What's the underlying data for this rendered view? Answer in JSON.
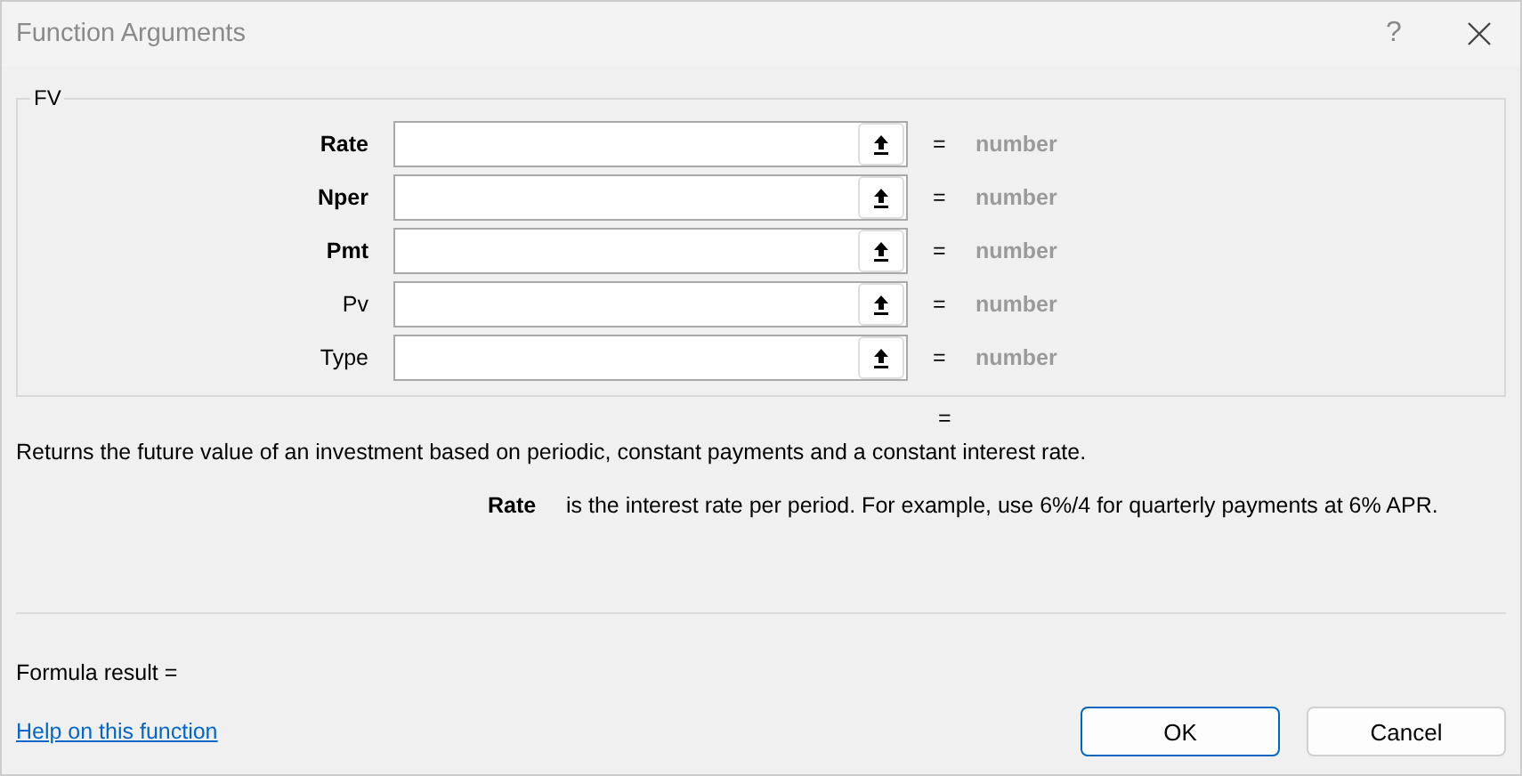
{
  "window": {
    "title": "Function Arguments",
    "help": "?"
  },
  "function": {
    "name": "FV",
    "arguments": [
      {
        "label": "Rate",
        "required": true,
        "equals": "=",
        "result": "number"
      },
      {
        "label": "Nper",
        "required": true,
        "equals": "=",
        "result": "number"
      },
      {
        "label": "Pmt",
        "required": true,
        "equals": "=",
        "result": "number"
      },
      {
        "label": "Pv",
        "required": false,
        "equals": "=",
        "result": "number"
      },
      {
        "label": "Type",
        "required": false,
        "equals": "=",
        "result": "number"
      }
    ],
    "result_equals": "="
  },
  "description": "Returns the future value of an investment based on periodic, constant payments and a constant interest rate.",
  "argument_help": {
    "name": "Rate",
    "text": "is the interest rate per period. For example, use 6%/4 for quarterly payments at 6% APR."
  },
  "formula_result": "Formula result =",
  "help_link": "Help on this function",
  "buttons": [
    {
      "label": "OK",
      "default": true
    },
    {
      "label": "Cancel",
      "default": false
    }
  ]
}
